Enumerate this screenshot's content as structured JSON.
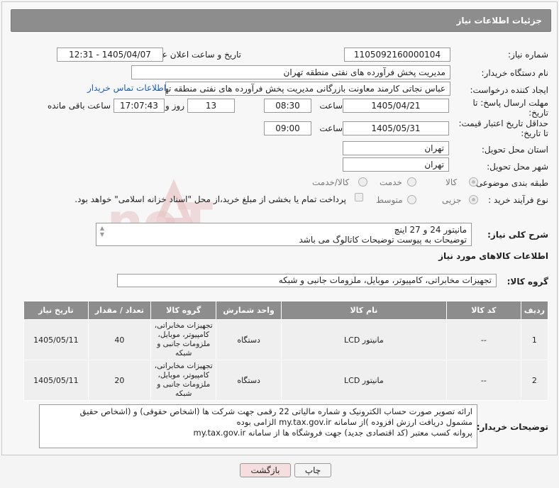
{
  "header": {
    "title": "جزئیات اطلاعات نیاز"
  },
  "fields": {
    "need_number_label": "شماره نیاز:",
    "need_number": "1105092160000104",
    "announce_label": "تاریخ و ساعت اعلان عمومی:",
    "announce_value": "1405/04/07 - 12:31",
    "buyer_label": "نام دستگاه خریدار:",
    "buyer_value": "مدیریت پخش فرآورده های نفتی منطقه تهران",
    "creator_label": "ایجاد کننده درخواست:",
    "creator_value": "عباس نجاتی کارمند معاونت بازرگانی مدیریت پخش فرآورده های نفتی منطقه تهران",
    "contact_link": "اطلاعات تماس خریدار",
    "deadline_label_1": "مهلت ارسال پاسخ: تا",
    "deadline_label_2": "تاریخ:",
    "deadline_date": "1405/04/21",
    "time_label": "ساعت",
    "deadline_time": "08:30",
    "days_value": "13",
    "days_label": "روز و",
    "remaining_time": "17:07:43",
    "remaining_label": "ساعت باقی مانده",
    "validity_label_1": "حداقل تاریخ اعتبار قیمت:",
    "validity_label_2": "تا تاریخ:",
    "validity_date": "1405/05/31",
    "validity_time": "09:00",
    "province_label": "استان محل تحویل:",
    "province_value": "تهران",
    "city_label": "شهر محل تحویل:",
    "city_value": "تهران",
    "category_label": "طبقه بندی موضوعی:",
    "category_options": [
      "کالا",
      "خدمت",
      "کالا/خدمت"
    ],
    "process_label": "نوع فرآیند خرید :",
    "process_options": [
      "جزیی",
      "متوسط"
    ],
    "payment_note": "پرداخت تمام یا بخشی از مبلغ خرید،از محل \"اسناد خزانه اسلامی\" خواهد بود."
  },
  "description": {
    "label": "شرح کلی نیاز:",
    "line1": "مانیتور 24 و 27 اینچ",
    "line2": "توضیحات به پیوست توضیحات کاتالوگ می باشد"
  },
  "goods": {
    "section_title": "اطلاعات کالاهای مورد نیاز",
    "group_label": "گروه کالا:",
    "group_value": "تجهیزات مخابراتی، کامپیوتر، موبایل، ملزومات جانبی و شبکه",
    "columns": [
      "ردیف",
      "کد کالا",
      "نام کالا",
      "واحد شمارش",
      "گروه کالا",
      "تعداد / مقدار",
      "تاریخ نیاز"
    ],
    "rows": [
      {
        "row": "1",
        "code": "--",
        "name": "مانیتور LCD",
        "unit": "دستگاه",
        "group": "تجهیزات مخابراتی، کامپیوتر، موبایل، ملزومات جانبی و شبکه",
        "qty": "40",
        "date": "1405/05/11"
      },
      {
        "row": "2",
        "code": "--",
        "name": "مانیتور LCD",
        "unit": "دستگاه",
        "group": "تجهیزات مخابراتی، کامپیوتر، موبایل، ملزومات جانبی و شبکه",
        "qty": "20",
        "date": "1405/05/11"
      }
    ]
  },
  "buyer_notes": {
    "label": "توضیحات خریدار:",
    "line1": "ارائه  تصویر صورت حساب الکترونیک و شماره مالیاتی 22 رقمی  جهت شرکت ها (اشخاص حقوقی) و (اشخاص حقیق",
    "line2": "مشمول دریافت ارزش افزوده )از سامانه my.tax.gov.ir  الزامی بوده",
    "line3": "پروانه کسب معتبر (کد اقتصادی جدید) جهت فروشگاه ها از سامانه my.tax.gov.ir"
  },
  "buttons": {
    "print": "چاپ",
    "back": "بازگشت"
  },
  "watermark": {
    "text": "AriaTender.neT"
  },
  "colors": {
    "header_bg": "#8d8d8d",
    "link": "#1a5fb4",
    "back_button_bg": "#f6dede",
    "watermark": "#e4b8b8"
  }
}
